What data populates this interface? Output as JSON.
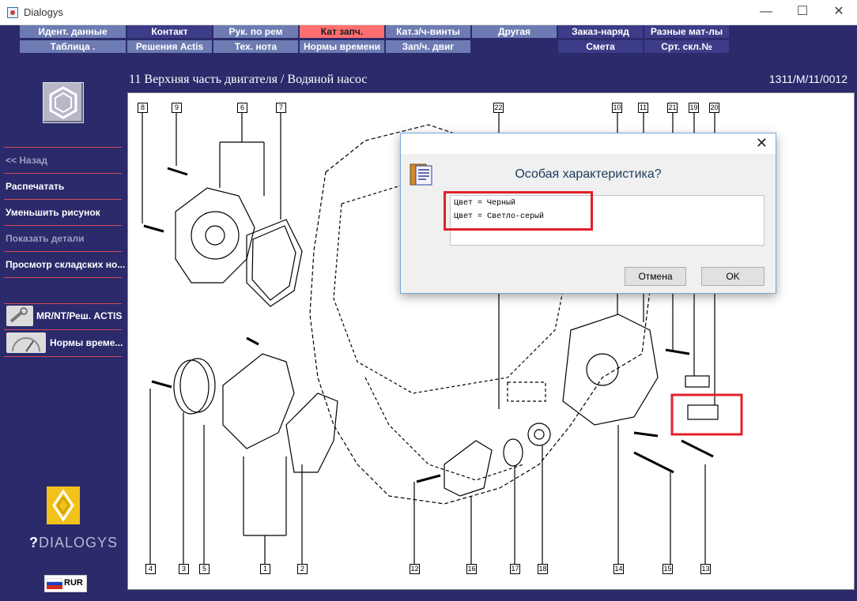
{
  "window": {
    "title": "Dialogys",
    "controls": [
      "—",
      "☐",
      "✕"
    ]
  },
  "menu": {
    "row1": [
      "Идент. данные",
      "Контакт",
      "Рук. по рем",
      "Кат запч.",
      "Кат.з/ч-винты",
      "Другая",
      "Заказ-наряд",
      "Разные мат-лы"
    ],
    "row2": [
      "Таблица .",
      "Решения Actis",
      "Тех. нота",
      "Нормы времени",
      "Зап/ч. двиг",
      "",
      "Смета",
      "Срт. скл.№"
    ],
    "active": "Кат запч."
  },
  "header": {
    "title": "11 Верхняя часть двигателя / Водяной насос",
    "code": "1311/M/11/0012"
  },
  "sidebar": {
    "items": [
      {
        "label": "<< Назад",
        "disabled": true
      },
      {
        "label": "Распечатать",
        "disabled": false
      },
      {
        "label": "Уменьшить рисунок",
        "disabled": false
      },
      {
        "label": "Показать детали",
        "disabled": true
      },
      {
        "label": "Просмотр складских но...",
        "disabled": false
      }
    ],
    "tools": [
      {
        "label": "MR/NT/Реш. ACTIS",
        "icon": "wrench-icon"
      },
      {
        "label": "Нормы време...",
        "icon": "gauge-icon"
      }
    ],
    "brand": "DIALOGYS",
    "currency": "RUR"
  },
  "diagram": {
    "callouts_top": [
      "8",
      "9",
      "6",
      "7",
      "22",
      "10",
      "11",
      "21",
      "19",
      "20"
    ],
    "callouts_bottom": [
      "4",
      "3",
      "5",
      "1",
      "2",
      "12",
      "16",
      "17",
      "18",
      "14",
      "15",
      "13"
    ]
  },
  "dialog": {
    "close": "✕",
    "question": "Особая характеристика?",
    "options": [
      "Цвет = Черный",
      "Цвет = Светло-серый"
    ],
    "cancel": "Отмена",
    "ok": "OK"
  },
  "colors": {
    "background": "#2b2a6b",
    "menu_light": "#6d7bb2",
    "menu_dark": "#3d3c88",
    "menu_active": "#ff6f6f",
    "separator": "#d04b57",
    "highlight": "#e2202a"
  }
}
